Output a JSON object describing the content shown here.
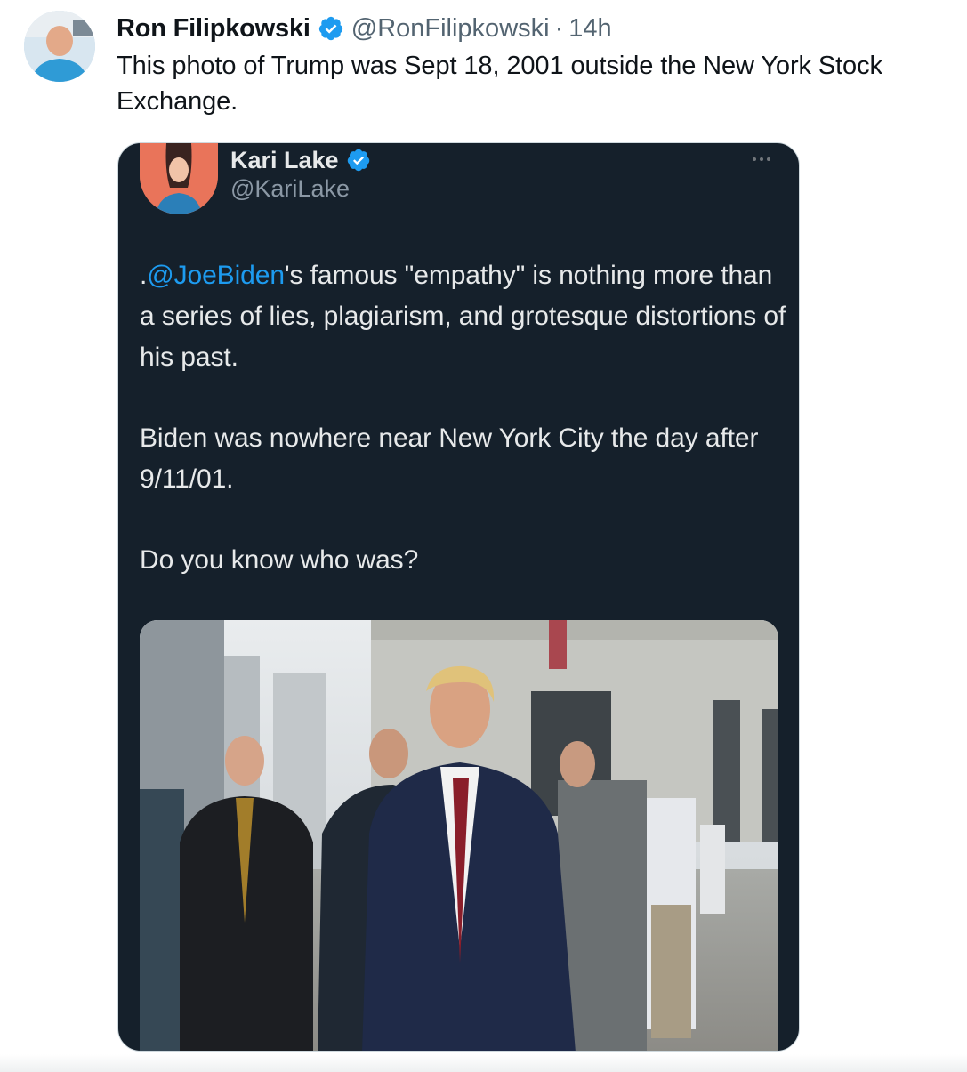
{
  "post": {
    "author_name": "Ron Filipkowski",
    "author_handle": "@RonFilipkowski",
    "separator": "·",
    "time": "14h",
    "text": "This photo of Trump was Sept 18, 2001 outside the New York Stock Exchange."
  },
  "quoted": {
    "author_name": "Kari Lake",
    "author_handle": "@KariLake",
    "mention": "@JoeBiden",
    "para1_prefix": ".",
    "para1_rest": "'s famous \"empathy\" is nothing more than a series of lies, plagiarism, and grotesque distortions of his past.",
    "para2": "Biden was nowhere near New York City the day after 9/11/01.",
    "para3": "Do you know who was?"
  },
  "icons": {
    "verified": "verified-badge-icon",
    "more": "more-options-icon"
  },
  "colors": {
    "verified_blue": "#1d9bf0",
    "dark_card": "#15202b",
    "mention": "#1d9bf0"
  }
}
